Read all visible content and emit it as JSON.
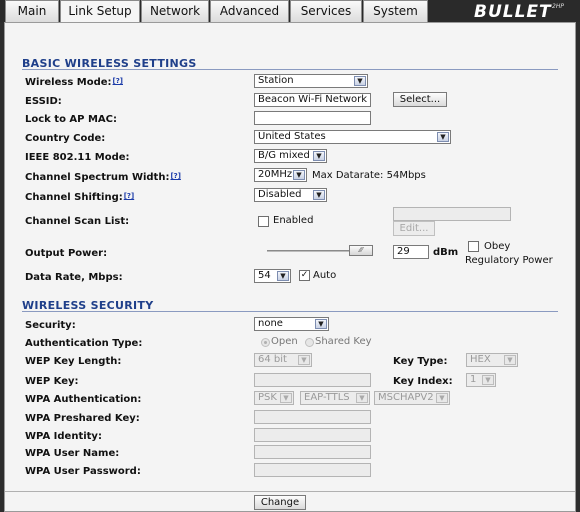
{
  "tabs": [
    "Main",
    "Link Setup",
    "Network",
    "Advanced",
    "Services",
    "System"
  ],
  "logo": {
    "text": "BULLET",
    "sup": "2HP"
  },
  "basic": {
    "title": "BASIC WIRELESS SETTINGS",
    "help_mark": "[?]",
    "wireless_mode": {
      "label": "Wireless Mode:",
      "value": "Station"
    },
    "essid": {
      "label": "ESSID:",
      "value": "Beacon Wi-Fi Network A",
      "button": "Select..."
    },
    "lock_ap": {
      "label": "Lock to AP MAC:",
      "value": ""
    },
    "country": {
      "label": "Country Code:",
      "value": "United States"
    },
    "ieee": {
      "label": "IEEE 802.11 Mode:",
      "value": "B/G mixed"
    },
    "spectrum": {
      "label": "Channel Spectrum Width:",
      "value": "20MHz",
      "datarate": "Max Datarate: 54Mbps"
    },
    "shifting": {
      "label": "Channel Shifting:",
      "value": "Disabled"
    },
    "scan": {
      "label": "Channel Scan List:",
      "enabled": "Enabled",
      "edit": "Edit..."
    },
    "power": {
      "label": "Output Power:",
      "value": "29",
      "unit": "dBm",
      "obey": "Obey",
      "regulatory": "Regulatory Power",
      "level": 1.0
    },
    "datarate": {
      "label": "Data Rate, Mbps:",
      "value": "54",
      "auto": "Auto"
    }
  },
  "security": {
    "title": "WIRELESS SECURITY",
    "security": {
      "label": "Security:",
      "value": "none"
    },
    "auth_type": {
      "label": "Authentication Type:",
      "open": "Open",
      "shared": "Shared Key"
    },
    "wep_len": {
      "label": "WEP Key Length:",
      "value": "64 bit"
    },
    "key_type": {
      "label": "Key Type:",
      "value": "HEX"
    },
    "wep_key": {
      "label": "WEP Key:"
    },
    "key_index": {
      "label": "Key Index:",
      "value": "1"
    },
    "wpa_auth": {
      "label": "WPA Authentication:",
      "v1": "PSK",
      "v2": "EAP-TTLS",
      "v3": "MSCHAPV2"
    },
    "wpa_psk": {
      "label": "WPA Preshared Key:"
    },
    "wpa_identity": {
      "label": "WPA Identity:"
    },
    "wpa_user": {
      "label": "WPA User Name:"
    },
    "wpa_pass": {
      "label": "WPA User Password:"
    }
  },
  "change_button": "Change"
}
